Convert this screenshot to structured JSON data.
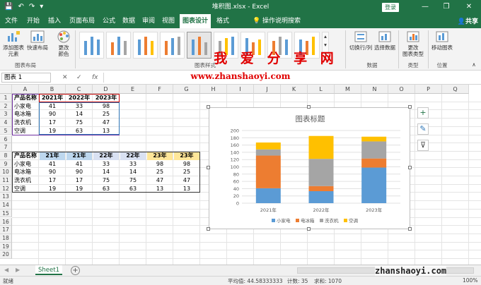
{
  "titlebar": {
    "filename": "堆积图.xlsx - Excel",
    "login": "登录",
    "minimize": "—",
    "restore": "❐",
    "close": "✕",
    "qa_save": "💾",
    "qa_undo": "↶",
    "qa_redo": "↷",
    "qa_more": "▾"
  },
  "menu": {
    "tabs": [
      "文件",
      "开始",
      "插入",
      "页面布局",
      "公式",
      "数据",
      "审阅",
      "视图",
      "图表设计",
      "格式"
    ],
    "active": "图表设计",
    "tell_me": "操作说明搜索",
    "share": "共享"
  },
  "ribbon": {
    "add_element": "添加图表\n元素",
    "quick_layout": "快速布局",
    "change_color": "更改\n颜色",
    "group_layout": "图表布局",
    "group_styles": "图表样式",
    "switch_row_col": "切换行/列",
    "select_data": "选择数据",
    "group_data": "数据",
    "change_type": "更改\n图表类型",
    "group_type": "类型",
    "move_chart": "移动图表",
    "group_location": "位置"
  },
  "watermark": {
    "title": "我 爱 分 享 网",
    "url": "www.zhanshaoyi.com",
    "corner": "zhanshaoyi.com"
  },
  "formula_bar": {
    "name_box": "图表 1",
    "fx": "fx",
    "cancel": "✕",
    "confirm": "✓"
  },
  "columns": [
    "A",
    "B",
    "C",
    "D",
    "E",
    "F",
    "G",
    "H",
    "I",
    "J",
    "K",
    "L",
    "M",
    "N",
    "O",
    "P",
    "Q"
  ],
  "rows": [
    "1",
    "2",
    "3",
    "4",
    "5",
    "6",
    "7",
    "8",
    "9",
    "10",
    "11",
    "12",
    "13",
    "14",
    "15",
    "16",
    "17",
    "18",
    "19",
    "20"
  ],
  "table1": {
    "header": [
      "产品名称",
      "2021年",
      "2022年",
      "2023年"
    ],
    "rows": [
      [
        "小家电",
        "41",
        "33",
        "98"
      ],
      [
        "电冰箱",
        "90",
        "14",
        "25"
      ],
      [
        "洗衣机",
        "17",
        "75",
        "47"
      ],
      [
        "空调",
        "19",
        "63",
        "13"
      ]
    ]
  },
  "table2": {
    "header": [
      "产品名称",
      "21年",
      "21年",
      "22年",
      "22年",
      "23年",
      "23年"
    ],
    "rows": [
      [
        "小家电",
        "41",
        "41",
        "33",
        "33",
        "98",
        "98"
      ],
      [
        "电冰箱",
        "90",
        "90",
        "14",
        "14",
        "25",
        "25"
      ],
      [
        "洗衣机",
        "17",
        "17",
        "75",
        "75",
        "47",
        "47"
      ],
      [
        "空调",
        "19",
        "19",
        "63",
        "63",
        "13",
        "13"
      ]
    ]
  },
  "chart_data": {
    "type": "bar",
    "stacked": true,
    "title": "图表标题",
    "categories": [
      "2021年",
      "2022年",
      "2023年"
    ],
    "series": [
      {
        "name": "小家电",
        "values": [
          41,
          33,
          98
        ],
        "color": "#5b9bd5"
      },
      {
        "name": "电冰箱",
        "values": [
          90,
          14,
          25
        ],
        "color": "#ed7d31"
      },
      {
        "name": "洗衣机",
        "values": [
          17,
          75,
          47
        ],
        "color": "#a5a5a5"
      },
      {
        "name": "空调",
        "values": [
          19,
          63,
          13
        ],
        "color": "#ffc000"
      }
    ],
    "ylim": [
      0,
      200
    ],
    "yticks": [
      "0",
      "20",
      "40",
      "60",
      "80",
      "100",
      "120",
      "140",
      "160",
      "180",
      "200"
    ],
    "grid": true,
    "legend": "bottom"
  },
  "chart_side": {
    "add": "+",
    "style": "✎",
    "filter": "⊽"
  },
  "sheet": {
    "tab": "Sheet1",
    "add": "+"
  },
  "status": {
    "ready": "就绪",
    "avg": "平均值: 44.58333333",
    "count": "计数: 35",
    "sum": "求和: 1070",
    "zoom": "100%"
  }
}
